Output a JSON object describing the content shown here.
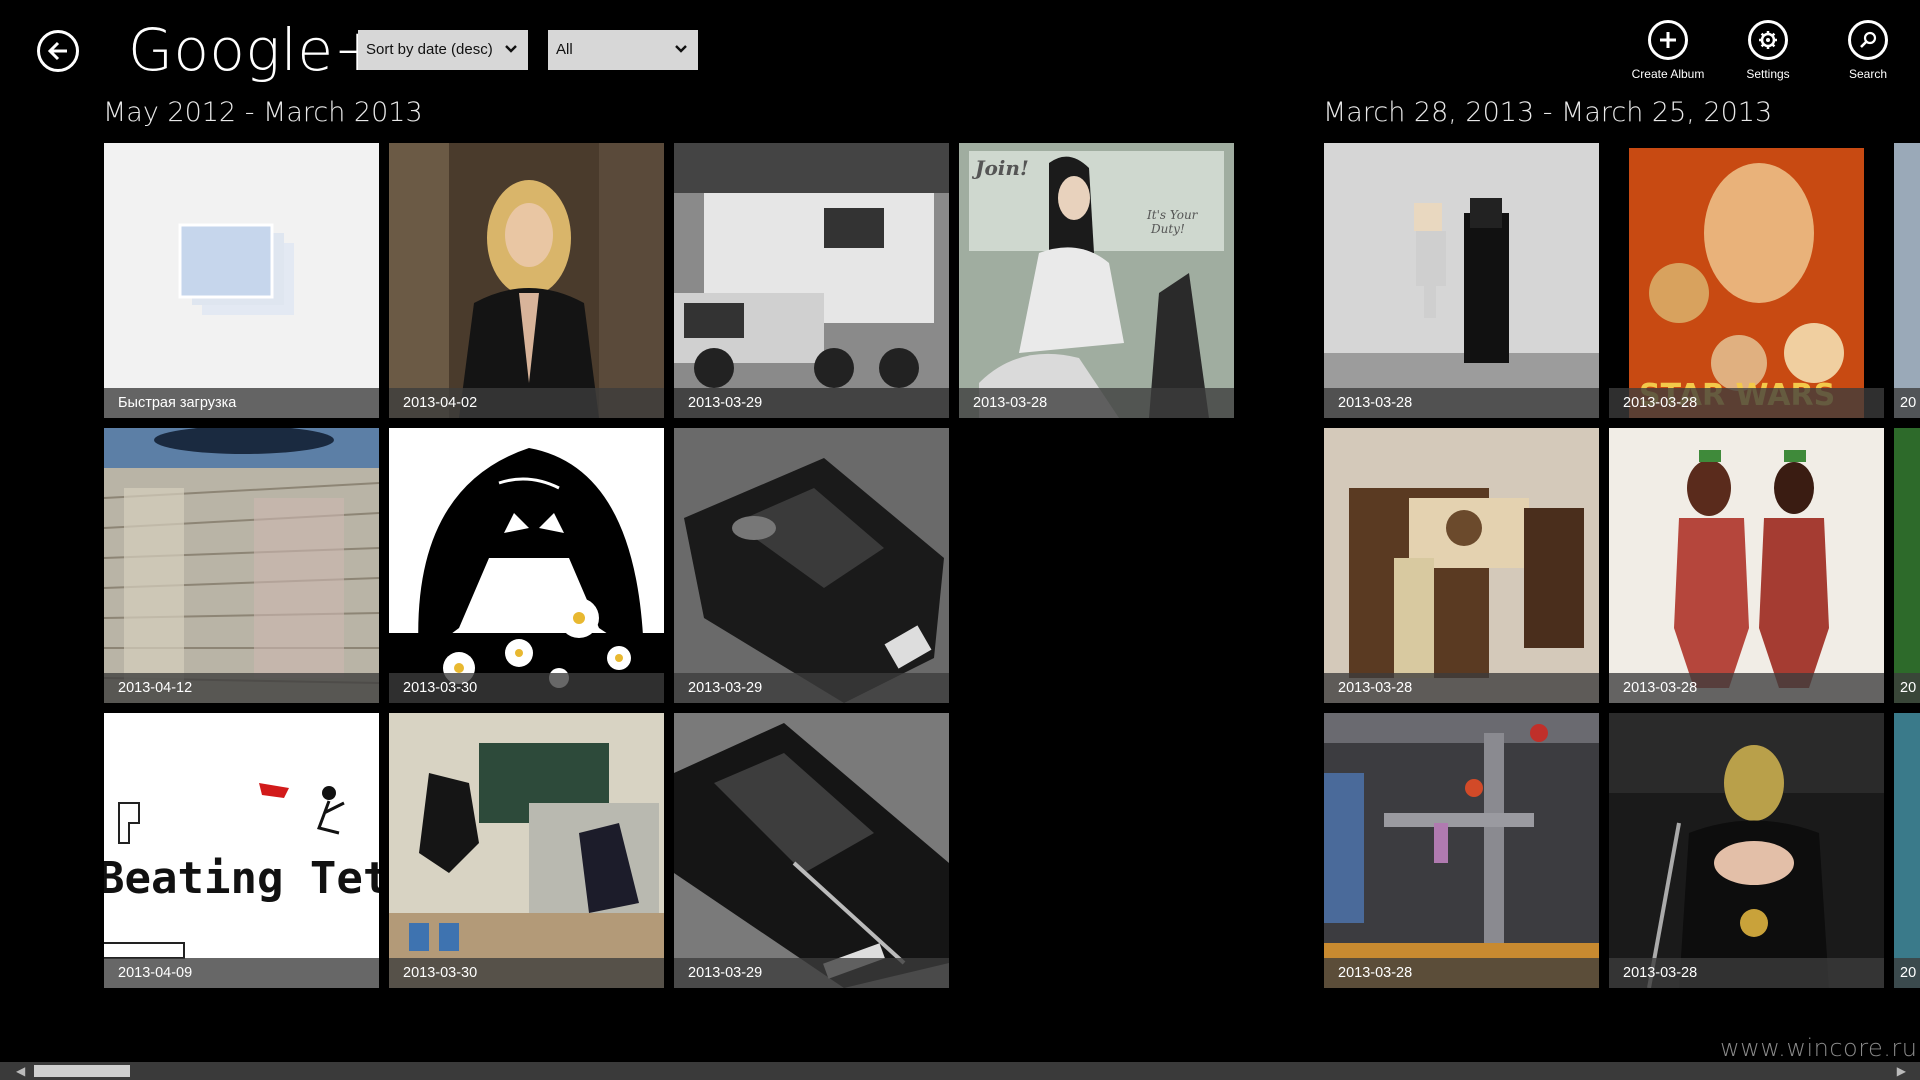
{
  "header": {
    "title": "Google+",
    "sort_dropdown": "Sort by date (desc)",
    "filter_dropdown": "All"
  },
  "appbar": {
    "create_album": "Create Album",
    "settings": "Settings",
    "search": "Search"
  },
  "sections": [
    {
      "title": "May 2012 - March 2013",
      "tiles": [
        {
          "caption": "Быстрая загрузка"
        },
        {
          "caption": "2013-04-02"
        },
        {
          "caption": "2013-03-29"
        },
        {
          "caption": "2013-03-28",
          "text": [
            "Join!",
            "It's Your",
            "Duty!"
          ]
        },
        {
          "caption": "2013-04-12"
        },
        {
          "caption": "2013-03-30"
        },
        {
          "caption": "2013-03-29"
        },
        {
          "caption": "2013-04-09",
          "text": [
            "Beating Tetri"
          ]
        },
        {
          "caption": "2013-03-30"
        },
        {
          "caption": "2013-03-29"
        }
      ]
    },
    {
      "title": "March 28, 2013 - March 25, 2013",
      "tiles": [
        {
          "caption": "2013-03-28"
        },
        {
          "caption": "2013-03-28",
          "text": [
            "STAR WARS"
          ]
        },
        {
          "caption": "20"
        },
        {
          "caption": "2013-03-28"
        },
        {
          "caption": "2013-03-28"
        },
        {
          "caption": "20"
        },
        {
          "caption": "2013-03-28"
        },
        {
          "caption": "2013-03-28"
        },
        {
          "caption": "20"
        }
      ]
    }
  ],
  "watermark": "www.wincore.ru",
  "colors": {
    "background": "#000000",
    "dropdown_bg": "#d7d7d7",
    "caption_bg": "#3c3c3c"
  }
}
